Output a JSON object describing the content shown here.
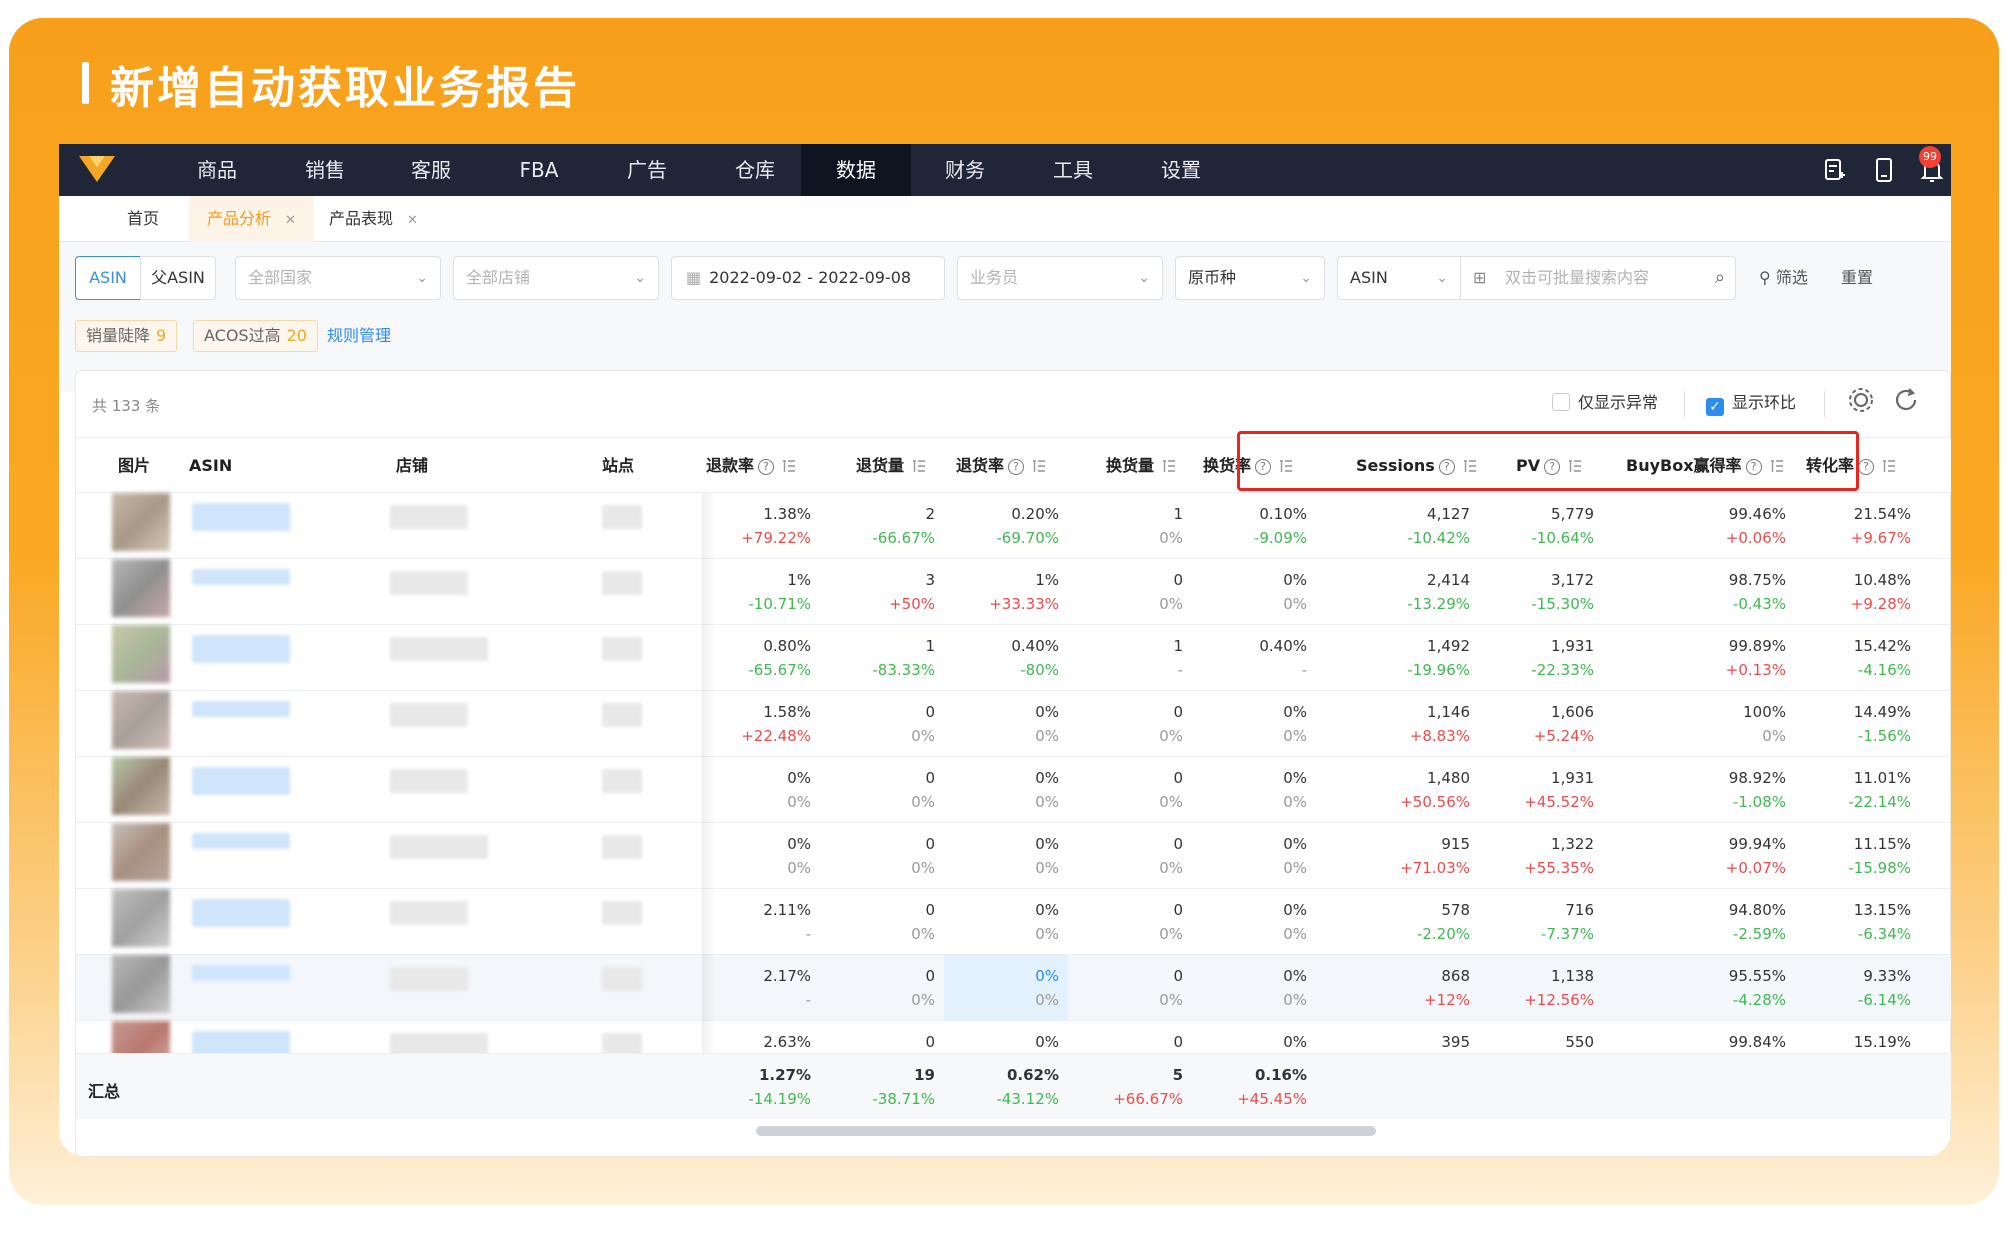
{
  "banner": {
    "title": "新增自动获取业务报告"
  },
  "nav": {
    "items": [
      "商品",
      "销售",
      "客服",
      "FBA",
      "广告",
      "仓库",
      "数据",
      "财务",
      "工具",
      "设置"
    ],
    "active": "数据",
    "notif_count": "99"
  },
  "tabs": [
    {
      "label": "首页"
    },
    {
      "label": "产品分析",
      "active": true
    },
    {
      "label": "产品表现"
    }
  ],
  "filters": {
    "asin_toggle": [
      "ASIN",
      "父ASIN"
    ],
    "country": "全部国家",
    "shop": "全部店铺",
    "date_start": "2022-09-02",
    "date_sep": "-",
    "date_end": "2022-09-08",
    "salesman": "业务员",
    "currency": "原币种",
    "search_type": "ASIN",
    "search_placeholder": "双击可批量搜索内容",
    "filter_btn": "筛选",
    "reset_btn": "重置",
    "tags": [
      {
        "label": "销量陡降",
        "count": "9"
      },
      {
        "label": "ACOS过高",
        "count": "20"
      }
    ],
    "rules_link": "规则管理"
  },
  "table": {
    "count": "共 133 条",
    "only_abnormal": "仅显示异常",
    "show_compare": "显示环比",
    "columns": {
      "img": "图片",
      "asin": "ASIN",
      "shop": "店铺",
      "site": "站点",
      "refund_rate": "退款率",
      "return_qty": "退货量",
      "return_rate": "退货率",
      "exchange_qty": "换货量",
      "exchange_rate": "换货率",
      "sessions": "Sessions",
      "pv": "PV",
      "buybox": "BuyBox赢得率",
      "conversion": "转化率"
    },
    "rows": [
      {
        "c": [
          [
            "1.38%",
            "+79.22%"
          ],
          [
            "2",
            "-66.67%"
          ],
          [
            "0.20%",
            "-69.70%"
          ],
          [
            "1",
            "0%"
          ],
          [
            "0.10%",
            "-9.09%"
          ],
          [
            "4,127",
            "-10.42%"
          ],
          [
            "5,779",
            "-10.64%"
          ],
          [
            "99.46%",
            "+0.06%"
          ],
          [
            "21.54%",
            "+9.67%"
          ]
        ]
      },
      {
        "c": [
          [
            "1%",
            "-10.71%"
          ],
          [
            "3",
            "+50%"
          ],
          [
            "1%",
            "+33.33%"
          ],
          [
            "0",
            "0%"
          ],
          [
            "0%",
            "0%"
          ],
          [
            "2,414",
            "-13.29%"
          ],
          [
            "3,172",
            "-15.30%"
          ],
          [
            "98.75%",
            "-0.43%"
          ],
          [
            "10.48%",
            "+9.28%"
          ]
        ]
      },
      {
        "c": [
          [
            "0.80%",
            "-65.67%"
          ],
          [
            "1",
            "-83.33%"
          ],
          [
            "0.40%",
            "-80%"
          ],
          [
            "1",
            "-"
          ],
          [
            "0.40%",
            "-"
          ],
          [
            "1,492",
            "-19.96%"
          ],
          [
            "1,931",
            "-22.33%"
          ],
          [
            "99.89%",
            "+0.13%"
          ],
          [
            "15.42%",
            "-4.16%"
          ]
        ]
      },
      {
        "c": [
          [
            "1.58%",
            "+22.48%"
          ],
          [
            "0",
            "0%"
          ],
          [
            "0%",
            "0%"
          ],
          [
            "0",
            "0%"
          ],
          [
            "0%",
            "0%"
          ],
          [
            "1,146",
            "+8.83%"
          ],
          [
            "1,606",
            "+5.24%"
          ],
          [
            "100%",
            "0%"
          ],
          [
            "14.49%",
            "-1.56%"
          ]
        ]
      },
      {
        "c": [
          [
            "0%",
            "0%"
          ],
          [
            "0",
            "0%"
          ],
          [
            "0%",
            "0%"
          ],
          [
            "0",
            "0%"
          ],
          [
            "0%",
            "0%"
          ],
          [
            "1,480",
            "+50.56%"
          ],
          [
            "1,931",
            "+45.52%"
          ],
          [
            "98.92%",
            "-1.08%"
          ],
          [
            "11.01%",
            "-22.14%"
          ]
        ]
      },
      {
        "c": [
          [
            "0%",
            "0%"
          ],
          [
            "0",
            "0%"
          ],
          [
            "0%",
            "0%"
          ],
          [
            "0",
            "0%"
          ],
          [
            "0%",
            "0%"
          ],
          [
            "915",
            "+71.03%"
          ],
          [
            "1,322",
            "+55.35%"
          ],
          [
            "99.94%",
            "+0.07%"
          ],
          [
            "11.15%",
            "-15.98%"
          ]
        ]
      },
      {
        "c": [
          [
            "2.11%",
            "-"
          ],
          [
            "0",
            "0%"
          ],
          [
            "0%",
            "0%"
          ],
          [
            "0",
            "0%"
          ],
          [
            "0%",
            "0%"
          ],
          [
            "578",
            "-2.20%"
          ],
          [
            "716",
            "-7.37%"
          ],
          [
            "94.80%",
            "-2.59%"
          ],
          [
            "13.15%",
            "-6.34%"
          ]
        ]
      },
      {
        "c": [
          [
            "2.17%",
            "-"
          ],
          [
            "0",
            "0%"
          ],
          [
            "0%",
            "0%"
          ],
          [
            "0",
            "0%"
          ],
          [
            "0%",
            "0%"
          ],
          [
            "868",
            "+12%"
          ],
          [
            "1,138",
            "+12.56%"
          ],
          [
            "95.55%",
            "-4.28%"
          ],
          [
            "9.33%",
            "-6.14%"
          ]
        ]
      },
      {
        "c": [
          [
            "2.63%",
            ""
          ],
          [
            "0",
            ""
          ],
          [
            "0%",
            ""
          ],
          [
            "0",
            ""
          ],
          [
            "0%",
            ""
          ],
          [
            "395",
            ""
          ],
          [
            "550",
            ""
          ],
          [
            "99.84%",
            ""
          ],
          [
            "15.19%",
            ""
          ]
        ]
      }
    ],
    "summary": {
      "label": "汇总",
      "c": [
        [
          "1.27%",
          "-14.19%"
        ],
        [
          "19",
          "-38.71%"
        ],
        [
          "0.62%",
          "-43.12%"
        ],
        [
          "5",
          "+66.67%"
        ],
        [
          "0.16%",
          "+45.45%"
        ]
      ]
    }
  }
}
